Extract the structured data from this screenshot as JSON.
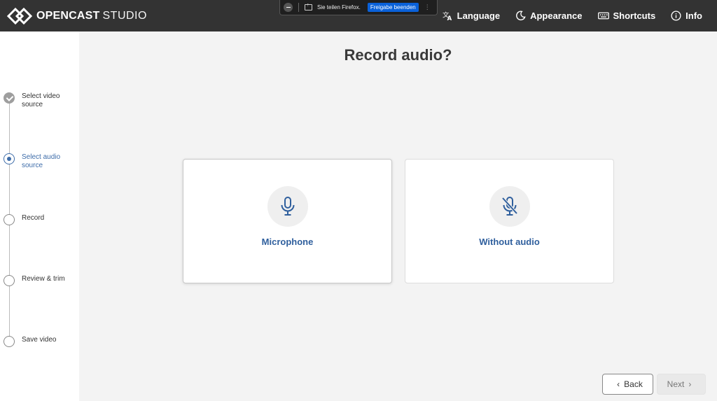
{
  "header": {
    "brand": "OPENCAST",
    "product": "STUDIO",
    "nav": [
      {
        "icon": "translate-icon",
        "label": "Language"
      },
      {
        "icon": "moon-icon",
        "label": "Appearance"
      },
      {
        "icon": "keyboard-icon",
        "label": "Shortcuts"
      },
      {
        "icon": "info-icon",
        "label": "Info"
      }
    ]
  },
  "share_bar": {
    "text": "Sie teilen Firefox.",
    "stop_label": "Freigabe beenden"
  },
  "steps": [
    {
      "label": "Select video source",
      "state": "done"
    },
    {
      "label": "Select audio source",
      "state": "active"
    },
    {
      "label": "Record",
      "state": "pending"
    },
    {
      "label": "Review & trim",
      "state": "pending"
    },
    {
      "label": "Save video",
      "state": "pending"
    }
  ],
  "main": {
    "title": "Record audio?",
    "options": [
      {
        "icon": "microphone-icon",
        "label": "Microphone",
        "selected": true
      },
      {
        "icon": "microphone-off-icon",
        "label": "Without audio",
        "selected": false
      }
    ]
  },
  "footer": {
    "back_label": "Back",
    "next_label": "Next"
  },
  "colors": {
    "header_bg": "#333333",
    "accent": "#3d6ca9",
    "option_text": "#2f5f9d",
    "share_button": "#0a61d9"
  }
}
